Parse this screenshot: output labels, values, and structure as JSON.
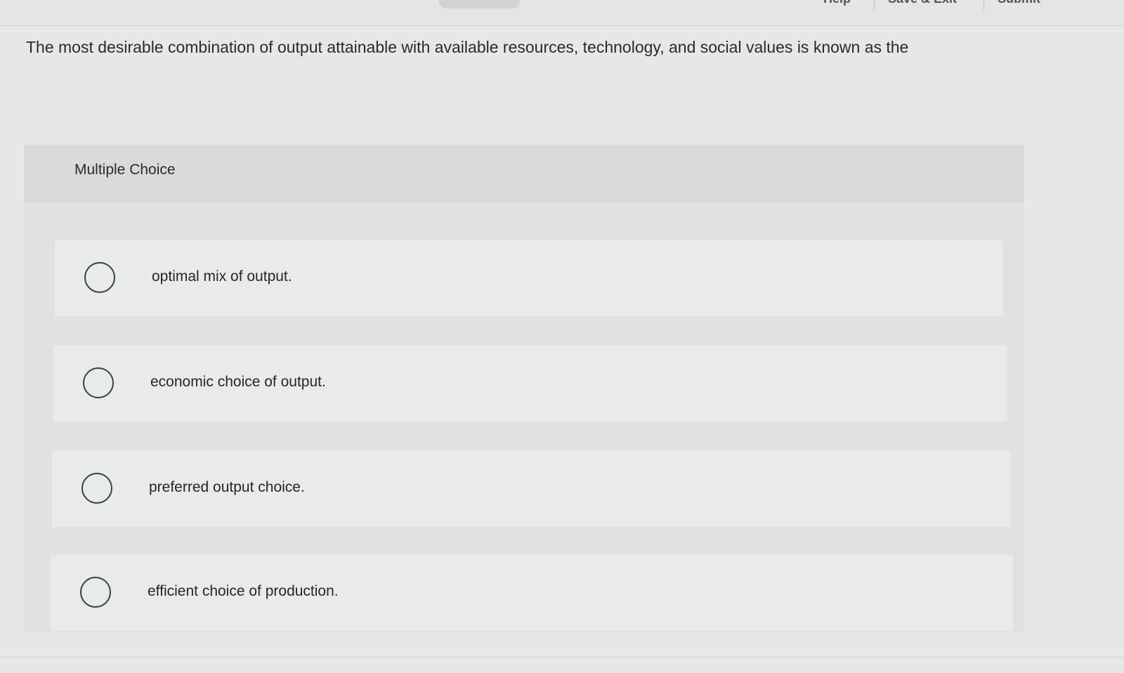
{
  "top_nav": {
    "items": [
      "Help",
      "Save & Exit",
      "Submit"
    ]
  },
  "question": {
    "text": "The most desirable combination of output attainable with available resources, technology, and social values is known as the"
  },
  "multiple_choice": {
    "label": "Multiple Choice",
    "options": [
      {
        "text": "optimal mix of output.",
        "selected": false
      },
      {
        "text": "economic choice of output.",
        "selected": false
      },
      {
        "text": "preferred output choice.",
        "selected": false
      },
      {
        "text": "efficient choice of production.",
        "selected": false
      }
    ]
  }
}
